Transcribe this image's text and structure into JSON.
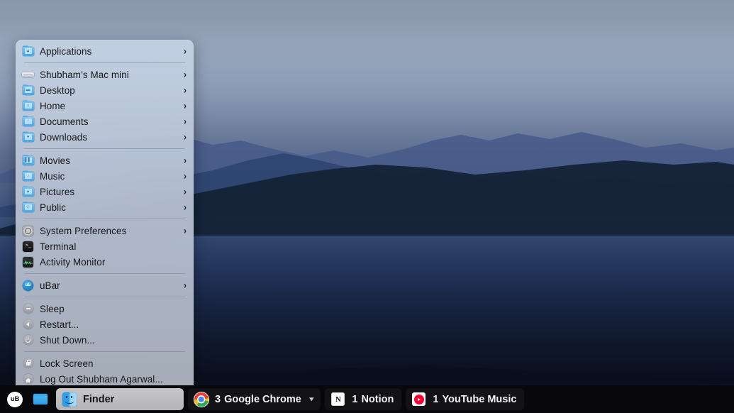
{
  "desktop": {
    "wallpaper_description": "blue-toned layered mountain range at dusk",
    "colors": {
      "sky_top": "#8a97ac",
      "mid_ridge": "#4d6085",
      "foreground": "#101a2d",
      "taskbar_bg": "#08080a",
      "menu_bg": "#c4d2e4",
      "accent_blue": "#4ba7e4"
    }
  },
  "context_menu": {
    "groups": [
      {
        "items": [
          {
            "label": "Applications",
            "icon": "folder-applications-icon",
            "submenu": true
          }
        ]
      },
      {
        "items": [
          {
            "label": "Shubham’s Mac mini",
            "icon": "mac-mini-icon",
            "submenu": true
          },
          {
            "label": "Desktop",
            "icon": "folder-desktop-icon",
            "submenu": true
          },
          {
            "label": "Home",
            "icon": "folder-home-icon",
            "submenu": true
          },
          {
            "label": "Documents",
            "icon": "folder-documents-icon",
            "submenu": true
          },
          {
            "label": "Downloads",
            "icon": "folder-downloads-icon",
            "submenu": true
          }
        ]
      },
      {
        "items": [
          {
            "label": "Movies",
            "icon": "folder-movies-icon",
            "submenu": true
          },
          {
            "label": "Music",
            "icon": "folder-music-icon",
            "submenu": true
          },
          {
            "label": "Pictures",
            "icon": "folder-pictures-icon",
            "submenu": true
          },
          {
            "label": "Public",
            "icon": "folder-public-icon",
            "submenu": true
          }
        ]
      },
      {
        "items": [
          {
            "label": "System Preferences",
            "icon": "system-preferences-icon",
            "submenu": true
          },
          {
            "label": "Terminal",
            "icon": "terminal-icon",
            "submenu": false
          },
          {
            "label": "Activity Monitor",
            "icon": "activity-monitor-icon",
            "submenu": false
          }
        ]
      },
      {
        "items": [
          {
            "label": "uBar",
            "icon": "ubar-icon",
            "submenu": true
          }
        ]
      },
      {
        "items": [
          {
            "label": "Sleep",
            "icon": "sleep-icon",
            "submenu": false
          },
          {
            "label": "Restart...",
            "icon": "restart-icon",
            "submenu": false
          },
          {
            "label": "Shut Down...",
            "icon": "shutdown-icon",
            "submenu": false
          }
        ]
      },
      {
        "items": [
          {
            "label": "Lock Screen",
            "icon": "lock-icon",
            "submenu": false
          },
          {
            "label": "Log Out Shubham Agarwal...",
            "icon": "logout-home-icon",
            "submenu": false
          }
        ]
      }
    ],
    "chevron_glyph": "›"
  },
  "taskbar": {
    "ubar_badge_label": "uB",
    "show_desktop_label": "",
    "tasks": [
      {
        "name": "Finder",
        "count": "",
        "active": true,
        "icon": "finder-icon",
        "caret": false
      },
      {
        "name": "Google Chrome",
        "count": "3",
        "active": false,
        "icon": "chrome-icon",
        "caret": true
      },
      {
        "name": "Notion",
        "count": "1",
        "active": false,
        "icon": "notion-icon",
        "caret": false
      },
      {
        "name": "YouTube Music",
        "count": "1",
        "active": false,
        "icon": "youtube-music-icon",
        "caret": false
      }
    ],
    "caret_glyph": "▾",
    "notion_glyph": "N"
  }
}
